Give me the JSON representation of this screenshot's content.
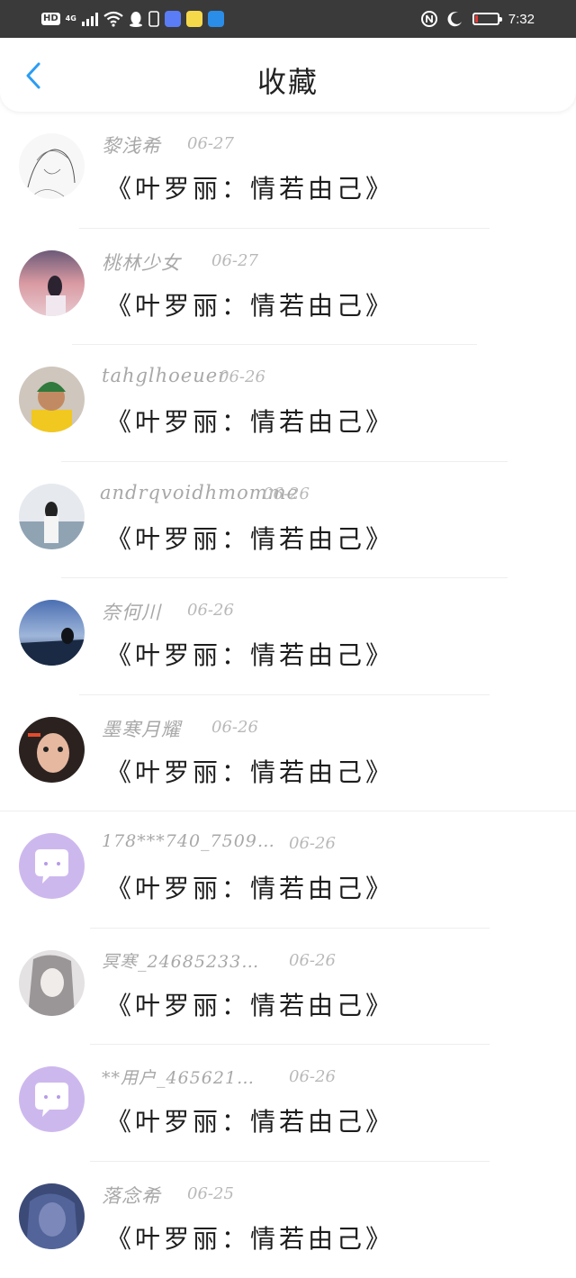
{
  "status_bar": {
    "hd": "HD",
    "network": "4G",
    "time": "7:32",
    "battery_level": 0.1,
    "icons": [
      "signal-icon",
      "wifi-icon",
      "qq-icon",
      "sim-icon",
      "music-app-icon",
      "emoji-app-icon",
      "map-app-icon",
      "nfc-icon",
      "moon-icon",
      "battery-icon"
    ]
  },
  "header": {
    "title": "收藏",
    "back_icon": "chevron-left-icon",
    "accent_color": "#2a9df4"
  },
  "items": [
    {
      "user": "黎浅希",
      "date": "06-27",
      "title": "《叶罗丽：情若由己》"
    },
    {
      "user": "桃林少女",
      "date": "06-27",
      "title": "《叶罗丽：情若由己》"
    },
    {
      "user": "tahglhoeuer",
      "date": "06-26",
      "title": "《叶罗丽：情若由己》"
    },
    {
      "user": "andrqvoidhmomme",
      "date": "06-26",
      "title": "《叶罗丽：情若由己》"
    },
    {
      "user": "奈何川",
      "date": "06-26",
      "title": "《叶罗丽：情若由己》"
    },
    {
      "user": "墨寒月耀",
      "date": "06-26",
      "title": "《叶罗丽：情若由己》"
    },
    {
      "user": "178***740_7509…",
      "date": "06-26",
      "title": "《叶罗丽：情若由己》"
    },
    {
      "user": "冥寒_24685233…",
      "date": "06-26",
      "title": "《叶罗丽：情若由己》"
    },
    {
      "user": "**用户_465621…",
      "date": "06-26",
      "title": "《叶罗丽：情若由己》"
    },
    {
      "user": "落念希",
      "date": "06-25",
      "title": "《叶罗丽：情若由己》"
    }
  ]
}
